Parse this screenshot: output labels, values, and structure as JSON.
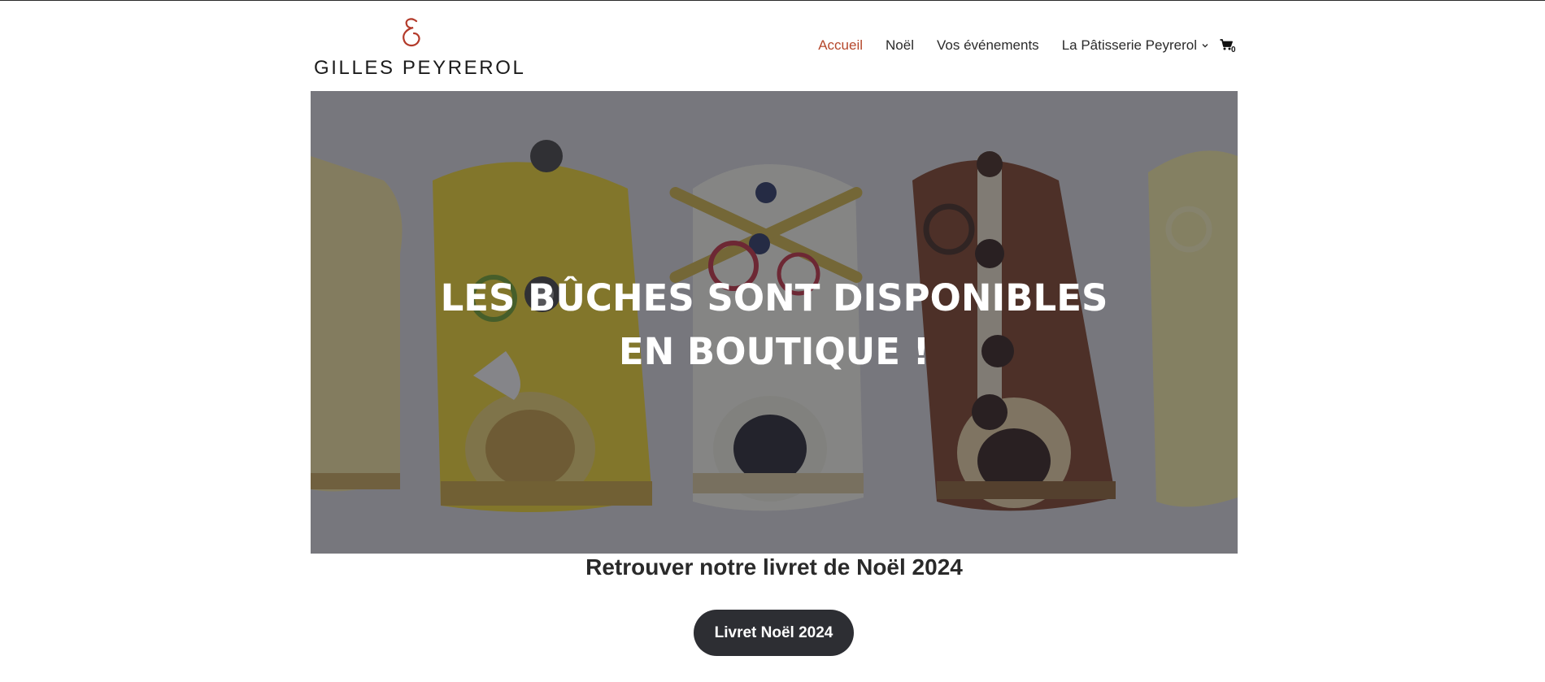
{
  "brand": {
    "name": "GILLES PEYREROL"
  },
  "nav": {
    "items": [
      {
        "label": "Accueil",
        "active": true
      },
      {
        "label": "Noël",
        "active": false
      },
      {
        "label": "Vos événements",
        "active": false
      },
      {
        "label": "La Pâtisserie Peyrerol",
        "active": false,
        "has_dropdown": true
      }
    ],
    "cart": {
      "icon": "cart-icon",
      "count": "0"
    }
  },
  "hero": {
    "title": "LES BÛCHES SONT DISPONIBLES EN BOUTIQUE !"
  },
  "section": {
    "subtitle": "Retrouver notre livret de Noël 2024",
    "button_label": "Livret Noël 2024"
  },
  "colors": {
    "accent": "#b5472b",
    "button_bg": "#2d2e33",
    "text": "#2b2b2b"
  }
}
